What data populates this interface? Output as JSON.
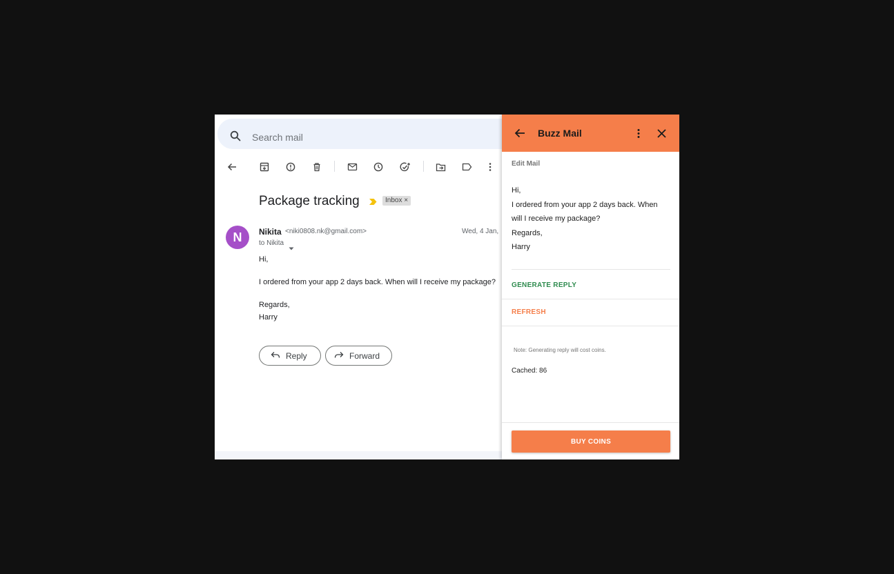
{
  "gmail": {
    "search_placeholder": "Search mail",
    "toolbar_icons": [
      "back-arrow-icon",
      "archive-icon",
      "report-spam-icon",
      "delete-icon",
      "mark-unread-icon",
      "snooze-icon",
      "add-to-tasks-icon",
      "move-to-icon",
      "label-icon",
      "more-vert-icon"
    ],
    "subject": "Package tracking",
    "label_chip": "Inbox",
    "label_chip_close": "×",
    "sender": {
      "initial": "N",
      "name": "Nikita",
      "email": "<niki0808.nk@gmail.com>",
      "date": "Wed, 4 Jan,",
      "to": "to Nikita"
    },
    "body": [
      "Hi,",
      "I ordered from your app 2 days back. When will I receive my package?",
      "Regards,",
      "Harry"
    ],
    "reply_label": "Reply",
    "forward_label": "Forward",
    "avatar_color": "#a54fc8"
  },
  "panel": {
    "title": "Buzz Mail",
    "accent_color": "#f57e4a",
    "edit_label": "Edit Mail",
    "draft_lines": [
      "Hi,",
      "I ordered from your app 2 days back. When",
      "will I receive my package?",
      "Regards,",
      "Harry"
    ],
    "generate_label": "GENERATE REPLY",
    "generate_color": "#2e8b4e",
    "refresh_label": "REFRESH",
    "note": "Note: Generating reply will cost coins.",
    "cached": "Cached: 86",
    "buy_label": "BUY COINS"
  }
}
